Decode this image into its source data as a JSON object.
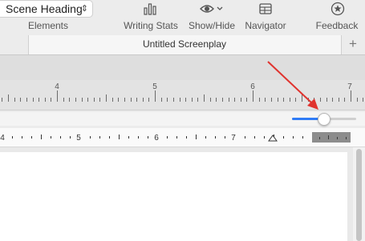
{
  "toolbar": {
    "style_selector": {
      "value": "Scene Heading",
      "label": "Elements"
    },
    "writing_stats": {
      "label": "Writing Stats",
      "icon": "bar-chart-icon"
    },
    "show_hide": {
      "label": "Show/Hide",
      "icon": "eye-icon"
    },
    "navigator": {
      "label": "Navigator",
      "icon": "table-icon"
    },
    "feedback": {
      "label": "Feedback",
      "icon": "star-icon"
    }
  },
  "tabs": {
    "active_title": "Untitled Screenplay",
    "add_label": "+"
  },
  "ruler_top": {
    "labels": [
      "4",
      "5",
      "6",
      "7"
    ]
  },
  "zoom_slider": {
    "value_fraction": 0.5,
    "accent": "#2f7cf6"
  },
  "ruler_page": {
    "labels": [
      "4",
      "5",
      "6",
      "7"
    ]
  },
  "annotation": {
    "color": "#e0332e"
  }
}
